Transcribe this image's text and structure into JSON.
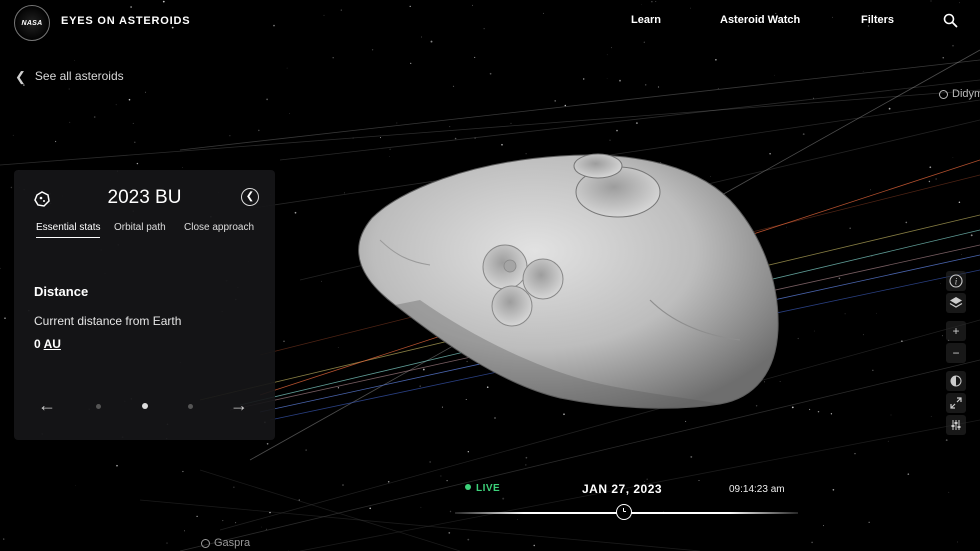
{
  "app": {
    "logo_text": "NASA",
    "title": "EYES ON ASTEROIDS"
  },
  "nav": {
    "learn": "Learn",
    "asteroid_watch": "Asteroid Watch",
    "filters": "Filters",
    "search_icon": "search-icon"
  },
  "back_link": "See all asteroids",
  "panel": {
    "title": "2023 BU",
    "icon": "asteroid-icon",
    "tabs": [
      {
        "label": "Essential stats",
        "active": true
      },
      {
        "label": "Orbital path",
        "active": false
      },
      {
        "label": "Close approach",
        "active": false
      }
    ],
    "section_heading": "Distance",
    "stat_label": "Current distance from Earth",
    "stat_value": "0",
    "stat_unit": "AU",
    "pager": {
      "page_count": 3,
      "current_page": 2
    }
  },
  "tools": [
    "info-icon",
    "layers-icon",
    "zoom-in-icon",
    "zoom-out-icon",
    "lighting-icon",
    "fullscreen-icon",
    "settings-sliders-icon"
  ],
  "time": {
    "live_label": "LIVE",
    "date": "JAN 27, 2023",
    "clock": "09:14:23 am"
  },
  "scene_labels": {
    "gaspra": "Gaspra",
    "didymos": "Didym"
  },
  "colors": {
    "background": "#000000",
    "live_green": "#3dd27a",
    "panel_bg": "#161618",
    "orbit_orange": "#e0643a",
    "orbit_blue": "#5b7dd8",
    "orbit_teal": "#7fd0c8"
  }
}
